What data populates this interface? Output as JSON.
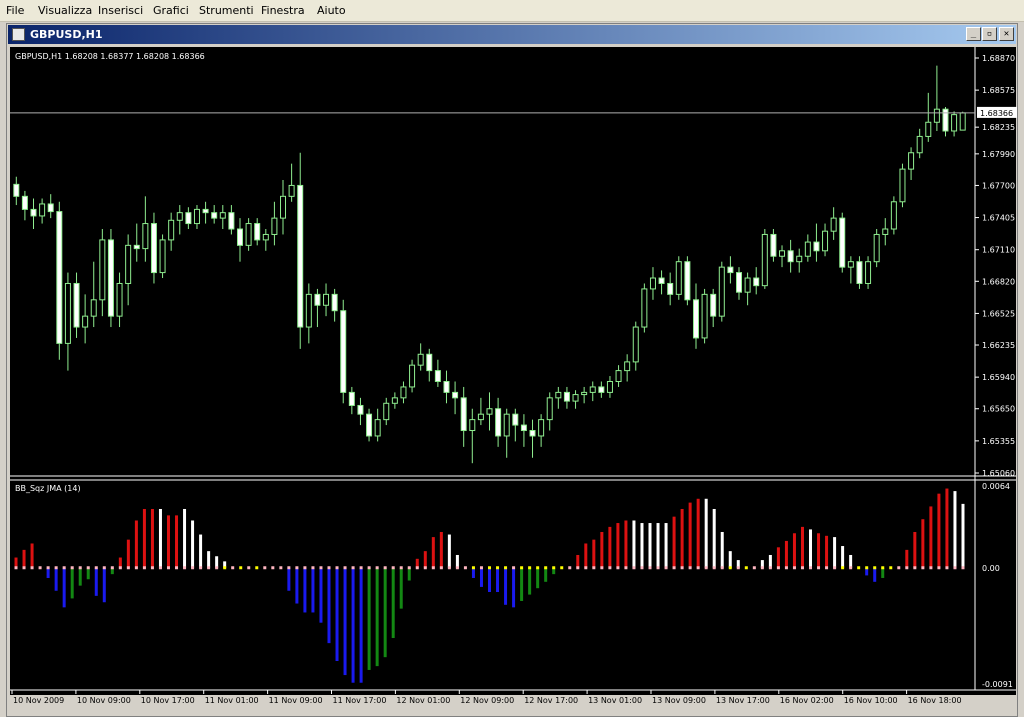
{
  "menu": {
    "items": [
      "File",
      "Visualizza",
      "Inserisci",
      "Grafici",
      "Strumenti",
      "Finestra",
      "Aiuto"
    ]
  },
  "window": {
    "title": "GBPUSD,H1",
    "buttons": [
      "minimize",
      "restore",
      "close"
    ]
  },
  "chart_header": "GBPUSD,H1  1.68208 1.68377 1.68208 1.68366",
  "indicator_label": "BB_Sqz JMA (14)",
  "colors": {
    "background": "#000000",
    "candle": "#90ee90",
    "bull_body": "#000000",
    "bear_body": "#ffffff",
    "hist_red": "#dd1111",
    "hist_white": "#ffffff",
    "hist_blue": "#1a1aee",
    "hist_green": "#138813",
    "dot_yellow": "#ffff00",
    "dot_pink": "#ffb6c1"
  },
  "chart_data": [
    {
      "type": "candlestick",
      "ylim": [
        1.6506,
        1.6887
      ],
      "yticks": [
        "1.68870",
        "1.68575",
        "1.68235",
        "1.67990",
        "1.67700",
        "1.67405",
        "1.67110",
        "1.66820",
        "1.66525",
        "1.66235",
        "1.65940",
        "1.65650",
        "1.65355",
        "1.65060"
      ],
      "current_price": "1.68366",
      "xticks": [
        "10 Nov 2009",
        "10 Nov 09:00",
        "10 Nov 17:00",
        "11 Nov 01:00",
        "11 Nov 09:00",
        "11 Nov 17:00",
        "12 Nov 01:00",
        "12 Nov 09:00",
        "12 Nov 17:00",
        "13 Nov 01:00",
        "13 Nov 09:00",
        "13 Nov 17:00",
        "16 Nov 02:00",
        "16 Nov 10:00",
        "16 Nov 18:00"
      ],
      "ohlc": [
        [
          1.6771,
          1.6778,
          1.6752,
          1.676
        ],
        [
          1.676,
          1.6765,
          1.6738,
          1.6748
        ],
        [
          1.6748,
          1.6758,
          1.673,
          1.6742
        ],
        [
          1.6742,
          1.6758,
          1.6735,
          1.6753
        ],
        [
          1.6753,
          1.6762,
          1.674,
          1.6746
        ],
        [
          1.6746,
          1.6755,
          1.661,
          1.6625
        ],
        [
          1.6625,
          1.669,
          1.66,
          1.668
        ],
        [
          1.668,
          1.669,
          1.663,
          1.664
        ],
        [
          1.664,
          1.667,
          1.6625,
          1.665
        ],
        [
          1.665,
          1.67,
          1.664,
          1.6665
        ],
        [
          1.6665,
          1.673,
          1.665,
          1.672
        ],
        [
          1.672,
          1.673,
          1.664,
          1.665
        ],
        [
          1.665,
          1.669,
          1.664,
          1.668
        ],
        [
          1.668,
          1.6725,
          1.666,
          1.6715
        ],
        [
          1.6715,
          1.6735,
          1.67,
          1.6712
        ],
        [
          1.6712,
          1.676,
          1.67,
          1.6735
        ],
        [
          1.6735,
          1.6745,
          1.668,
          1.669
        ],
        [
          1.669,
          1.6725,
          1.6685,
          1.672
        ],
        [
          1.672,
          1.6745,
          1.671,
          1.6738
        ],
        [
          1.6738,
          1.6752,
          1.6725,
          1.6745
        ],
        [
          1.6745,
          1.675,
          1.673,
          1.6735
        ],
        [
          1.6735,
          1.6752,
          1.673,
          1.6748
        ],
        [
          1.6748,
          1.6755,
          1.6735,
          1.6745
        ],
        [
          1.6745,
          1.6752,
          1.6735,
          1.674
        ],
        [
          1.674,
          1.6752,
          1.673,
          1.6745
        ],
        [
          1.6745,
          1.6752,
          1.6725,
          1.673
        ],
        [
          1.673,
          1.674,
          1.67,
          1.6715
        ],
        [
          1.6715,
          1.674,
          1.671,
          1.6735
        ],
        [
          1.6735,
          1.674,
          1.6715,
          1.672
        ],
        [
          1.672,
          1.673,
          1.671,
          1.6725
        ],
        [
          1.6725,
          1.6755,
          1.6715,
          1.674
        ],
        [
          1.674,
          1.6775,
          1.6725,
          1.676
        ],
        [
          1.676,
          1.679,
          1.6755,
          1.677
        ],
        [
          1.677,
          1.68,
          1.662,
          1.664
        ],
        [
          1.664,
          1.668,
          1.6625,
          1.667
        ],
        [
          1.667,
          1.6675,
          1.664,
          1.666
        ],
        [
          1.666,
          1.668,
          1.665,
          1.667
        ],
        [
          1.667,
          1.6675,
          1.6645,
          1.6655
        ],
        [
          1.6655,
          1.6665,
          1.657,
          1.658
        ],
        [
          1.658,
          1.6585,
          1.656,
          1.6568
        ],
        [
          1.6568,
          1.6575,
          1.655,
          1.656
        ],
        [
          1.656,
          1.6565,
          1.6535,
          1.654
        ],
        [
          1.654,
          1.6565,
          1.6535,
          1.6555
        ],
        [
          1.6555,
          1.6575,
          1.655,
          1.657
        ],
        [
          1.657,
          1.658,
          1.6565,
          1.6575
        ],
        [
          1.6575,
          1.659,
          1.657,
          1.6585
        ],
        [
          1.6585,
          1.661,
          1.658,
          1.6605
        ],
        [
          1.6605,
          1.6625,
          1.66,
          1.6615
        ],
        [
          1.6615,
          1.662,
          1.659,
          1.66
        ],
        [
          1.66,
          1.661,
          1.6585,
          1.659
        ],
        [
          1.659,
          1.66,
          1.657,
          1.658
        ],
        [
          1.658,
          1.659,
          1.656,
          1.6575
        ],
        [
          1.6575,
          1.6585,
          1.653,
          1.6545
        ],
        [
          1.6545,
          1.6565,
          1.6515,
          1.6555
        ],
        [
          1.6555,
          1.6575,
          1.655,
          1.656
        ],
        [
          1.656,
          1.658,
          1.6545,
          1.6565
        ],
        [
          1.6565,
          1.6575,
          1.653,
          1.654
        ],
        [
          1.654,
          1.6565,
          1.652,
          1.656
        ],
        [
          1.656,
          1.6565,
          1.6535,
          1.655
        ],
        [
          1.655,
          1.656,
          1.653,
          1.6545
        ],
        [
          1.6545,
          1.6555,
          1.652,
          1.654
        ],
        [
          1.654,
          1.656,
          1.653,
          1.6555
        ],
        [
          1.6555,
          1.658,
          1.6545,
          1.6575
        ],
        [
          1.6575,
          1.6585,
          1.6565,
          1.658
        ],
        [
          1.658,
          1.6585,
          1.6565,
          1.6572
        ],
        [
          1.6572,
          1.6582,
          1.6565,
          1.6578
        ],
        [
          1.6578,
          1.6585,
          1.657,
          1.658
        ],
        [
          1.658,
          1.659,
          1.6572,
          1.6585
        ],
        [
          1.6585,
          1.659,
          1.6575,
          1.658
        ],
        [
          1.658,
          1.6595,
          1.6575,
          1.659
        ],
        [
          1.659,
          1.6605,
          1.6585,
          1.66
        ],
        [
          1.66,
          1.6615,
          1.659,
          1.6608
        ],
        [
          1.6608,
          1.6645,
          1.66,
          1.664
        ],
        [
          1.664,
          1.668,
          1.6635,
          1.6675
        ],
        [
          1.6675,
          1.6695,
          1.6665,
          1.6685
        ],
        [
          1.6685,
          1.6692,
          1.667,
          1.668
        ],
        [
          1.668,
          1.669,
          1.666,
          1.667
        ],
        [
          1.667,
          1.6705,
          1.6665,
          1.67
        ],
        [
          1.67,
          1.6705,
          1.666,
          1.6665
        ],
        [
          1.6665,
          1.668,
          1.662,
          1.663
        ],
        [
          1.663,
          1.6675,
          1.6625,
          1.667
        ],
        [
          1.667,
          1.6675,
          1.664,
          1.665
        ],
        [
          1.665,
          1.67,
          1.6645,
          1.6695
        ],
        [
          1.6695,
          1.6705,
          1.668,
          1.669
        ],
        [
          1.669,
          1.6695,
          1.6665,
          1.6672
        ],
        [
          1.6672,
          1.669,
          1.666,
          1.6685
        ],
        [
          1.6685,
          1.6695,
          1.667,
          1.6678
        ],
        [
          1.6678,
          1.673,
          1.6675,
          1.6725
        ],
        [
          1.6725,
          1.673,
          1.67,
          1.6705
        ],
        [
          1.6705,
          1.6715,
          1.6695,
          1.671
        ],
        [
          1.671,
          1.672,
          1.669,
          1.67
        ],
        [
          1.67,
          1.6712,
          1.669,
          1.6705
        ],
        [
          1.6705,
          1.6725,
          1.67,
          1.6718
        ],
        [
          1.6718,
          1.6735,
          1.67,
          1.671
        ],
        [
          1.671,
          1.6735,
          1.6705,
          1.6728
        ],
        [
          1.6728,
          1.675,
          1.672,
          1.674
        ],
        [
          1.674,
          1.6745,
          1.669,
          1.6695
        ],
        [
          1.6695,
          1.6705,
          1.668,
          1.67
        ],
        [
          1.67,
          1.6705,
          1.6675,
          1.668
        ],
        [
          1.668,
          1.6705,
          1.6675,
          1.67
        ],
        [
          1.67,
          1.673,
          1.6695,
          1.6725
        ],
        [
          1.6725,
          1.674,
          1.6715,
          1.673
        ],
        [
          1.673,
          1.676,
          1.6725,
          1.6755
        ],
        [
          1.6755,
          1.679,
          1.675,
          1.6785
        ],
        [
          1.6785,
          1.6805,
          1.6775,
          1.68
        ],
        [
          1.68,
          1.6822,
          1.6795,
          1.6815
        ],
        [
          1.6815,
          1.6855,
          1.681,
          1.6828
        ],
        [
          1.6828,
          1.688,
          1.682,
          1.684
        ],
        [
          1.684,
          1.6842,
          1.6815,
          1.682
        ],
        [
          1.682,
          1.6838,
          1.6815,
          1.6835
        ],
        [
          1.68208,
          1.68377,
          1.68208,
          1.68366
        ]
      ]
    },
    {
      "type": "histogram",
      "title": "BB_Sqz JMA (14)",
      "ylim": [
        -0.0091,
        0.0064
      ],
      "yticks": [
        "0.0064",
        "0.00",
        "-0.0091"
      ],
      "values": [
        0.0008,
        0.0014,
        0.0019,
        0.0,
        -0.0008,
        -0.0018,
        -0.0031,
        -0.0024,
        -0.0014,
        -0.0009,
        -0.0022,
        -0.0027,
        -0.0005,
        0.0008,
        0.0022,
        0.0037,
        0.0046,
        0.0046,
        0.0046,
        0.0041,
        0.0041,
        0.0046,
        0.0037,
        0.0026,
        0.0013,
        0.0009,
        0.0005,
        0.0,
        0.0,
        0.0,
        0.0,
        0.0,
        0.0,
        0.0,
        -0.0018,
        -0.0028,
        -0.0035,
        -0.0035,
        -0.0043,
        -0.0059,
        -0.0073,
        -0.0084,
        -0.009,
        -0.009,
        -0.008,
        -0.0077,
        -0.007,
        -0.0055,
        -0.0032,
        -0.001,
        0.0007,
        0.0013,
        0.0024,
        0.0028,
        0.0026,
        0.001,
        0.0,
        -0.0008,
        -0.0015,
        -0.0019,
        -0.0019,
        -0.0029,
        -0.0031,
        -0.0026,
        -0.0021,
        -0.0016,
        -0.0011,
        -0.0005,
        0.0,
        0.0,
        0.001,
        0.0019,
        0.0022,
        0.0028,
        0.0032,
        0.0035,
        0.0037,
        0.0037,
        0.0035,
        0.0035,
        0.0035,
        0.0035,
        0.004,
        0.0046,
        0.0051,
        0.0054,
        0.0054,
        0.0046,
        0.0028,
        0.0013,
        0.0006,
        0.0,
        0.0,
        0.0006,
        0.001,
        0.0016,
        0.0021,
        0.0027,
        0.0032,
        0.003,
        0.0027,
        0.0025,
        0.0024,
        0.0017,
        0.001,
        0.0,
        -0.0006,
        -0.0011,
        -0.0008,
        0.0,
        0.0,
        0.0014,
        0.0028,
        0.0038,
        0.0048,
        0.0058,
        0.0062,
        0.006,
        0.005
      ],
      "colors": [
        "r",
        "r",
        "r",
        "w",
        "b",
        "b",
        "b",
        "g",
        "g",
        "g",
        "b",
        "b",
        "g",
        "r",
        "r",
        "r",
        "r",
        "r",
        "w",
        "r",
        "r",
        "w",
        "w",
        "w",
        "w",
        "w",
        "w",
        "w",
        "w",
        "w",
        "w",
        "w",
        "w",
        "w",
        "b",
        "b",
        "b",
        "b",
        "b",
        "b",
        "b",
        "b",
        "b",
        "b",
        "g",
        "g",
        "g",
        "g",
        "g",
        "g",
        "r",
        "r",
        "r",
        "r",
        "w",
        "w",
        "w",
        "b",
        "b",
        "b",
        "b",
        "b",
        "b",
        "g",
        "g",
        "g",
        "g",
        "g",
        "w",
        "w",
        "r",
        "r",
        "r",
        "r",
        "r",
        "r",
        "r",
        "w",
        "w",
        "w",
        "w",
        "w",
        "r",
        "r",
        "r",
        "r",
        "w",
        "w",
        "w",
        "w",
        "w",
        "w",
        "w",
        "w",
        "w",
        "r",
        "r",
        "r",
        "r",
        "w",
        "r",
        "r",
        "w",
        "w",
        "w",
        "w",
        "b",
        "b",
        "g",
        "w",
        "w",
        "r",
        "r",
        "r",
        "r",
        "r",
        "r",
        "w",
        "w"
      ],
      "dots": [
        "p",
        "p",
        "p",
        "p",
        "p",
        "p",
        "p",
        "p",
        "p",
        "p",
        "p",
        "p",
        "p",
        "p",
        "p",
        "p",
        "p",
        "p",
        "p",
        "p",
        "p",
        "p",
        "p",
        "p",
        "p",
        "p",
        "y",
        "p",
        "y",
        "p",
        "y",
        "p",
        "p",
        "p",
        "p",
        "p",
        "p",
        "p",
        "p",
        "p",
        "p",
        "p",
        "p",
        "p",
        "p",
        "p",
        "p",
        "p",
        "p",
        "p",
        "p",
        "p",
        "p",
        "p",
        "p",
        "p",
        "p",
        "y",
        "p",
        "y",
        "y",
        "y",
        "p",
        "y",
        "y",
        "y",
        "y",
        "y",
        "y",
        "p",
        "p",
        "p",
        "p",
        "p",
        "p",
        "p",
        "p",
        "p",
        "p",
        "p",
        "p",
        "p",
        "p",
        "p",
        "p",
        "p",
        "p",
        "p",
        "p",
        "y",
        "p",
        "y",
        "p",
        "p",
        "p",
        "p",
        "p",
        "p",
        "p",
        "p",
        "p",
        "p",
        "p",
        "y",
        "p",
        "y",
        "y",
        "y",
        "y",
        "y",
        "p",
        "p",
        "p",
        "p",
        "p",
        "p",
        "p",
        "p",
        "p"
      ]
    }
  ]
}
